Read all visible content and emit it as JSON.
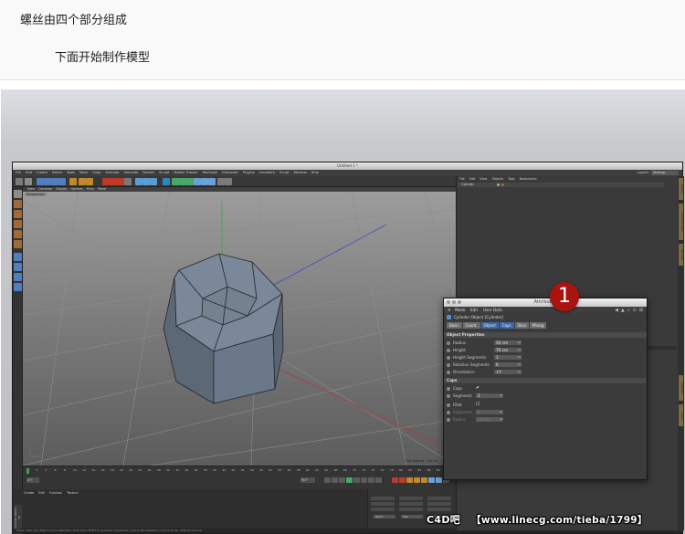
{
  "post": {
    "line1": "螺丝由四个部分组成",
    "line2": "下面开始制作模型"
  },
  "window": {
    "title": "Untitled 1 *",
    "layout_label": "Layout:",
    "layout_value": "Startup",
    "menus": [
      "File",
      "Edit",
      "Create",
      "Select",
      "Tools",
      "Mesh",
      "Snap",
      "Animate",
      "Simulate",
      "Render",
      "Sculpt",
      "Motion Tracker",
      "MoGraph",
      "Character",
      "Plugins",
      "Lenslearn",
      "Script",
      "Window",
      "Help"
    ]
  },
  "viewport": {
    "menus": [
      "View",
      "Cameras",
      "Display",
      "Options",
      "Filter",
      "Panel"
    ],
    "label": "Perspective",
    "grid_info": "Grid Spacing : 100 cm"
  },
  "timeline": {
    "frames": [
      "0",
      "2",
      "4",
      "6",
      "8",
      "10",
      "12",
      "14",
      "16",
      "18",
      "20",
      "22",
      "24",
      "26",
      "28",
      "30",
      "32",
      "34",
      "36",
      "38",
      "40",
      "42",
      "44",
      "46",
      "48",
      "50",
      "52",
      "54",
      "56",
      "58",
      "60",
      "62",
      "64",
      "66",
      "68",
      "70",
      "72",
      "74",
      "76",
      "78",
      "80",
      "82",
      "84",
      "86",
      "88",
      "90"
    ],
    "current_frame": "0 F",
    "end_frame": "90 F"
  },
  "material_menu": [
    "Create",
    "Edit",
    "Function",
    "Texture"
  ],
  "coord_buttons": {
    "apply": "Apply",
    "world": "World",
    "size": "Size"
  },
  "status_text": "Move: Click and drag to move elements. Hold down SHIFT to quantize movement / add to the selection in point mode, CTRL to remove.",
  "side_label": "MAXON CINEMA 4D",
  "object_manager": {
    "menus": [
      "File",
      "Edit",
      "View",
      "Objects",
      "Tags",
      "Bookmarks"
    ],
    "item": "Cylinder"
  },
  "right_tabs": [
    "Objects",
    "Content Browser",
    "Structure",
    "Attributes",
    "Layers"
  ],
  "attributes": {
    "title": "Attributes",
    "menus": [
      "Mode",
      "Edit",
      "User Data"
    ],
    "object_title": "Cylinder Object [Cylinder]",
    "tabs": [
      "Basic",
      "Coord.",
      "Object",
      "Caps",
      "Slice",
      "Phong"
    ],
    "active_tab": "Object",
    "sections": {
      "object_properties": "Object Properties",
      "caps": "Caps"
    },
    "fields": {
      "radius": {
        "label": "Radius",
        "value": "50 cm"
      },
      "height": {
        "label": "Height",
        "value": "70 cm"
      },
      "height_segments": {
        "label": "Height Segments",
        "value": "1"
      },
      "rotation_segments": {
        "label": "Rotation Segments",
        "value": "6"
      },
      "orientation": {
        "label": "Orientation",
        "value": "+Y"
      },
      "caps": {
        "label": "Caps",
        "value": "✔"
      },
      "segments": {
        "label": "Segments",
        "value": "2"
      },
      "fillet": {
        "label": "Fillet",
        "value": "☐"
      },
      "fillet_segments": {
        "label": "Segments",
        "value": "3"
      },
      "fillet_radius": {
        "label": "Radius",
        "value": "20 cm"
      }
    }
  },
  "badge": "1",
  "watermark": {
    "part1": "C4D吧",
    "part2": "【www.linecg.com/tieba/1799】"
  },
  "colors": {
    "badge": "#a9140f",
    "active_tab": "#3d68a8",
    "cylinder_face": "#6a7889"
  }
}
